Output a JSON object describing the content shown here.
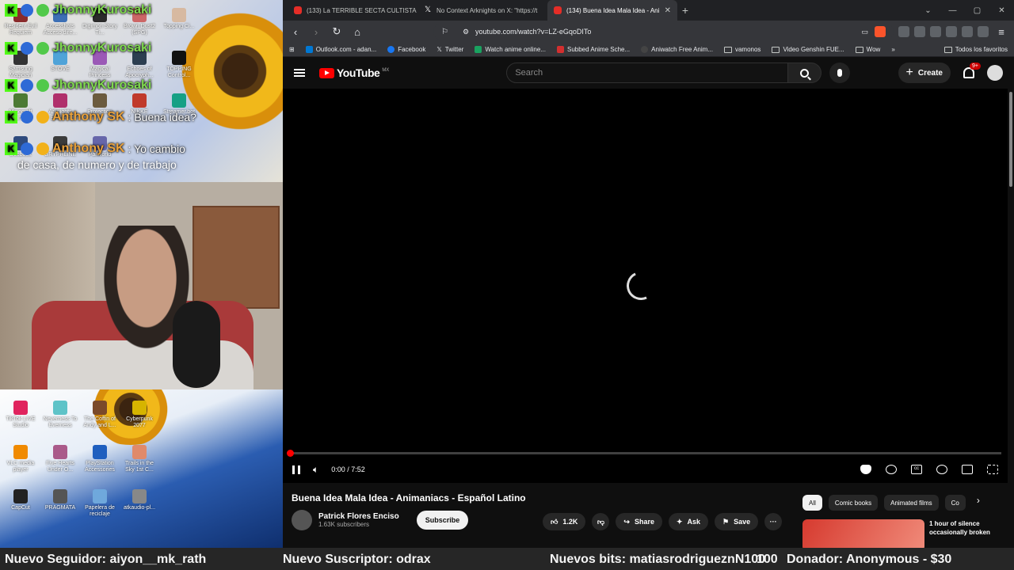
{
  "overlay": {
    "chat": [
      {
        "user": "JhonnyKurosaki",
        "message": ""
      },
      {
        "user": "JhonnyKurosaki",
        "message": ""
      },
      {
        "user": "JhonnyKurosaki",
        "message": ""
      },
      {
        "user": "Anthony SK",
        "message": ": Buena idea?"
      },
      {
        "user": "Anthony SK",
        "message": ": Yo cambio"
      }
    ],
    "chat_continuation": "de casa, de numero y de trabajo",
    "user_colors": {
      "JhonnyKurosaki": "#7fd94f",
      "Anthony SK": "#e9a13b"
    },
    "desktop_icons_top": [
      "Resident Evil Requiem",
      "Accesshots Acceso dire...",
      "Digimon Story Ti...",
      "Brown Dust2 (SPG)",
      "Topping Ci...",
      "Samsung Magician",
      "STOVE",
      "Magical Princess",
      "Echoes of Apocryph...",
      "TOPPING Control...",
      "Minecraft Launcher",
      "Arknights Endfield",
      "Protection",
      "NIKKE",
      "Streamer.bot",
      "Docbook",
      "GRYPHLINE",
      "PalWorld"
    ],
    "desktop_icons_bottom": [
      "TikTok LIVE Studio",
      "Neverness To Everness",
      "The Coffin of Andy and L...",
      "Cyberpunk 2077",
      "VLC media player",
      "Five Hearts Under O...",
      "PlayStation Accessories",
      "Trails in the Sky 1st C...",
      "CapCut",
      "PRAGMATA",
      "Papelera de reciclaje",
      "atkaudio-pl..."
    ]
  },
  "browser": {
    "tabs": [
      {
        "title": "(133) La TERRIBLE SECTA CULTISTA de",
        "icon": "youtube-icon",
        "active": false
      },
      {
        "title": "No Context Arknights on X: \"https://t",
        "icon": "x-icon",
        "active": false
      },
      {
        "title": "(134) Buena Idea Mala Idea - Ani",
        "icon": "youtube-icon",
        "active": true
      }
    ],
    "new_tab": "+",
    "url": "youtube.com/watch?v=LZ-eGqoDITo",
    "bookmarks": [
      {
        "label": "Outlook.com - adan...",
        "color": "#0078d4"
      },
      {
        "label": "Facebook",
        "color": "#1877f2"
      },
      {
        "label": "Twitter",
        "color": "#000000"
      },
      {
        "label": "Watch anime online...",
        "color": "#1aa260"
      },
      {
        "label": "Subbed Anime Sche...",
        "color": "#d32f2f"
      },
      {
        "label": "Aniwatch Free Anim...",
        "color": "#222222"
      }
    ],
    "bookmark_folders": [
      "vamonos",
      "Video Genshin FUE...",
      "Wow"
    ],
    "all_bookmarks": "Todos los favoritos",
    "overflow": "»"
  },
  "youtube": {
    "logo": "YouTube",
    "region": "MX",
    "search_placeholder": "Search",
    "create_label": "Create",
    "notifications": "9+",
    "player": {
      "time": "0:00 / 7:52",
      "progress": 0,
      "accent": "#ff0000"
    },
    "video_title": "Buena Idea Mala Idea - Animaniacs - Español Latino",
    "channel": {
      "name": "Patrick Flores Enciso",
      "subscribers": "1.63K subscribers"
    },
    "subscribe_label": "Subscribe",
    "actions": {
      "likes": "1.2K",
      "share": "Share",
      "ask": "Ask",
      "save": "Save",
      "more": "···"
    },
    "chips": [
      "All",
      "Comic books",
      "Animated films",
      "Co"
    ],
    "recommendation": {
      "title": "1 hour of silence occasionally broken"
    }
  },
  "ticker": {
    "follower": "Nuevo Seguidor: aiyon__mk_rath",
    "subscriber": "Nuevo Suscriptor: odrax",
    "bits": "Nuevos bits: matiasrodrigueznN100",
    "bits_overlap": "100",
    "donor": "Donador: Anonymous - $30"
  }
}
